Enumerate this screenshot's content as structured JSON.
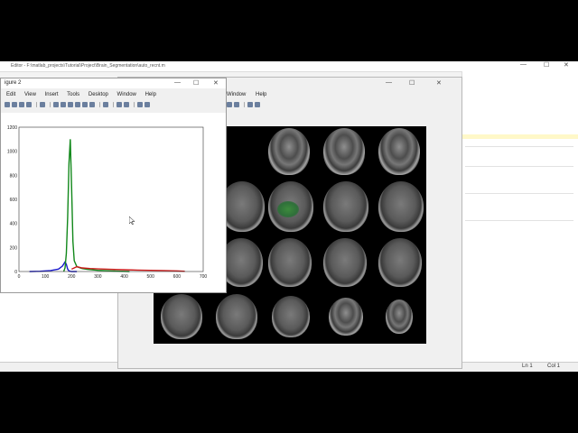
{
  "editor": {
    "title": "Editor - F:\\matlab_projects\\Tutorial\\Project\\Brain_Segmentation\\auto_recnt.m",
    "status_ln": "Ln 1",
    "status_col": "Col 1"
  },
  "figure1": {
    "menu": [
      "Window",
      "Help"
    ]
  },
  "figure2": {
    "title": "igure 2",
    "menu": [
      "Edit",
      "View",
      "Insert",
      "Tools",
      "Desktop",
      "Window",
      "Help"
    ]
  },
  "window_controls": {
    "minimize": "—",
    "maximize": "☐",
    "close": "✕"
  },
  "chart_data": {
    "type": "line",
    "xlim": [
      0,
      700
    ],
    "ylim": [
      0,
      1200
    ],
    "xticks": [
      0,
      100,
      200,
      300,
      400,
      500,
      600,
      700
    ],
    "yticks": [
      0,
      200,
      400,
      600,
      800,
      1000,
      1200
    ],
    "series": [
      {
        "color": "#1a1acc",
        "x": [
          40,
          80,
          120,
          150,
          165,
          175,
          180,
          185,
          190,
          200,
          220
        ],
        "y": [
          0,
          2,
          8,
          20,
          45,
          80,
          60,
          20,
          5,
          0,
          0
        ]
      },
      {
        "color": "#11881a",
        "x": [
          170,
          175,
          180,
          185,
          190,
          195,
          200,
          205,
          210,
          220,
          240,
          260,
          300,
          350,
          420
        ],
        "y": [
          0,
          30,
          150,
          450,
          900,
          1100,
          700,
          250,
          90,
          40,
          25,
          18,
          10,
          5,
          0
        ]
      },
      {
        "color": "#cc1a1a",
        "x": [
          200,
          220,
          240,
          270,
          300,
          350,
          400,
          450,
          500,
          550,
          600,
          630
        ],
        "y": [
          20,
          40,
          30,
          25,
          22,
          18,
          15,
          12,
          10,
          8,
          5,
          2
        ]
      }
    ]
  }
}
